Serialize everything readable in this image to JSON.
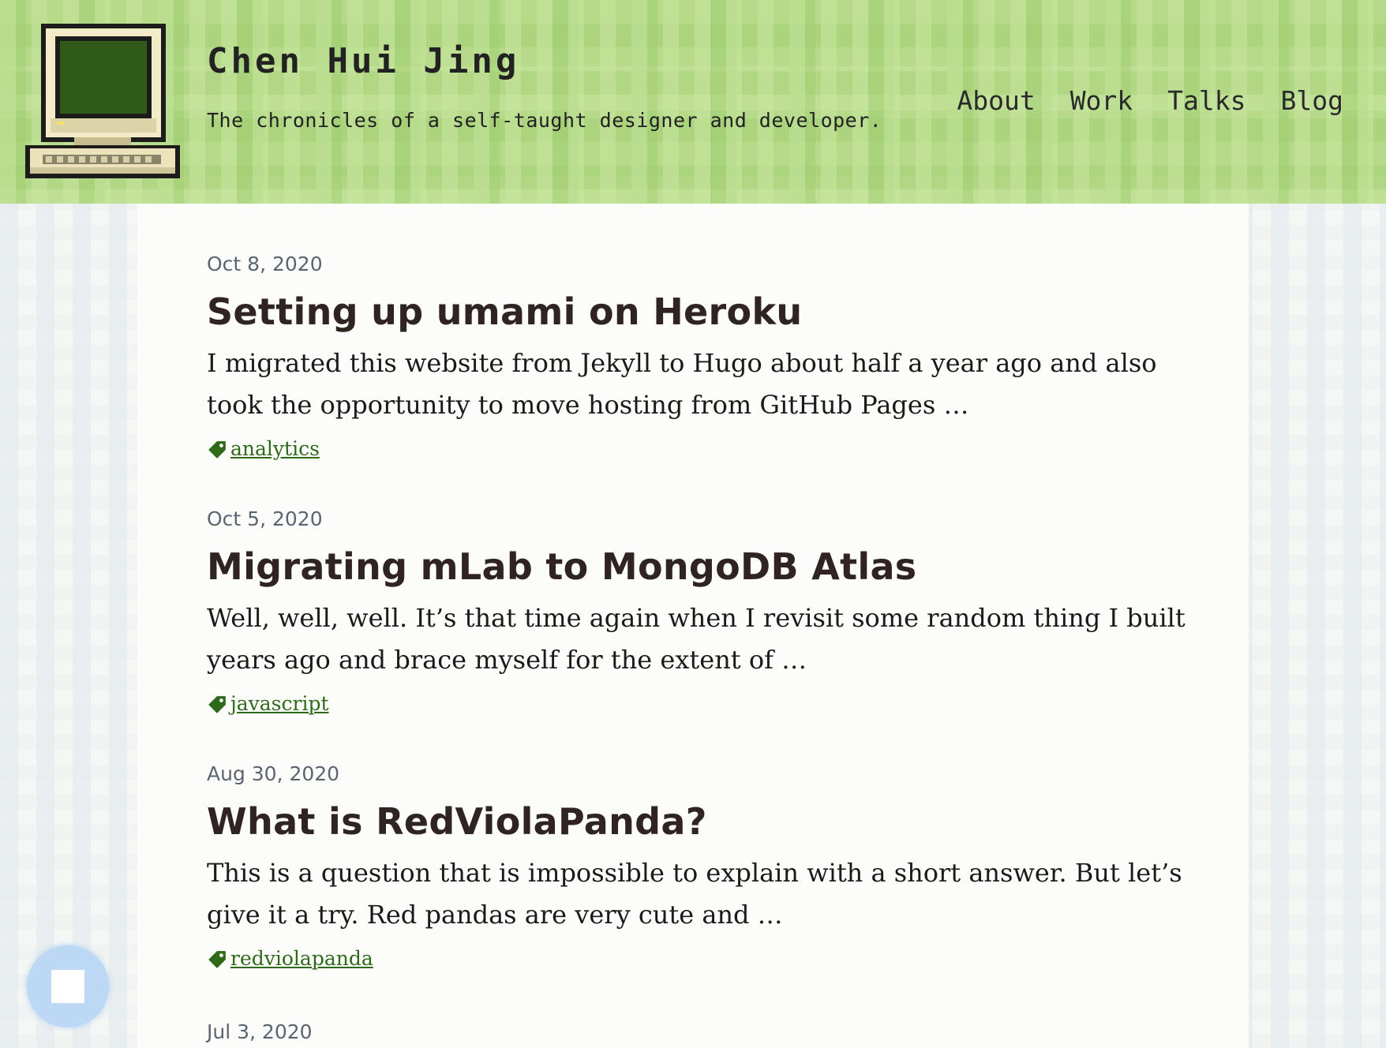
{
  "header": {
    "title": "Chen Hui Jing",
    "tagline": "The chronicles of a self-taught designer and developer.",
    "logo_icon": "retro-computer-icon"
  },
  "nav": [
    {
      "label": "About"
    },
    {
      "label": "Work"
    },
    {
      "label": "Talks"
    },
    {
      "label": "Blog"
    }
  ],
  "posts": [
    {
      "date": "Oct 8, 2020",
      "title": "Setting up umami on Heroku",
      "excerpt": "I migrated this website from Jekyll to Hugo about half a year ago and also took the opportunity to move hosting from GitHub Pages …",
      "tag": "analytics"
    },
    {
      "date": "Oct 5, 2020",
      "title": "Migrating mLab to MongoDB Atlas",
      "excerpt": "Well, well, well. It’s that time again when I revisit some random thing I built years ago and brace myself for the extent of …",
      "tag": "javascript"
    },
    {
      "date": "Aug 30, 2020",
      "title": "What is RedViolaPanda?",
      "excerpt": "This is a question that is impossible to explain with a short answer. But let’s give it a try. Red pandas are very cute and …",
      "tag": "redviolapanda"
    },
    {
      "date": "Jul 3, 2020"
    }
  ],
  "colors": {
    "header_bg": "#b6d98a",
    "title_text": "#2f2422",
    "tag_link": "#2f6a1a",
    "date_text": "#5c6470",
    "float_button": "#bcd8f4"
  },
  "icons": {
    "tag": "tag-icon",
    "float_button": "stop-square-icon"
  }
}
